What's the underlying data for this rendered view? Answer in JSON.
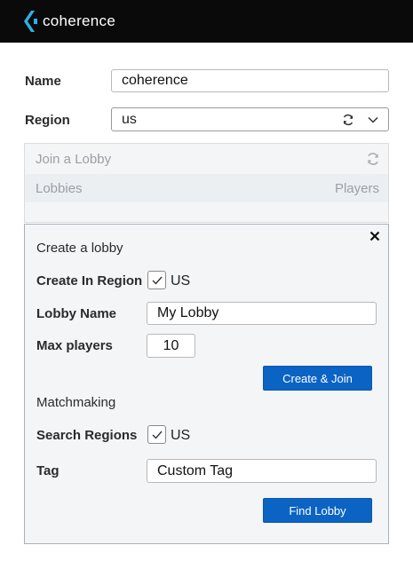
{
  "app": {
    "brand": "coherence"
  },
  "form": {
    "name_label": "Name",
    "name_value": "coherence",
    "region_label": "Region",
    "region_value": "us"
  },
  "join": {
    "title": "Join a Lobby",
    "col_lobbies": "Lobbies",
    "col_players": "Players"
  },
  "create": {
    "title": "Create a lobby",
    "region_label": "Create In Region",
    "region_checked": true,
    "region_option": "US",
    "lobby_name_label": "Lobby Name",
    "lobby_name_value": "My Lobby",
    "max_players_label": "Max players",
    "max_players_value": "10",
    "create_button": "Create & Join"
  },
  "matchmaking": {
    "title": "Matchmaking",
    "search_label": "Search Regions",
    "search_checked": true,
    "search_option": "US",
    "tag_label": "Tag",
    "tag_value": "Custom Tag",
    "find_button": "Find Lobby"
  },
  "colors": {
    "accent": "#0b63c4",
    "topbar": "#0a0a0a"
  }
}
